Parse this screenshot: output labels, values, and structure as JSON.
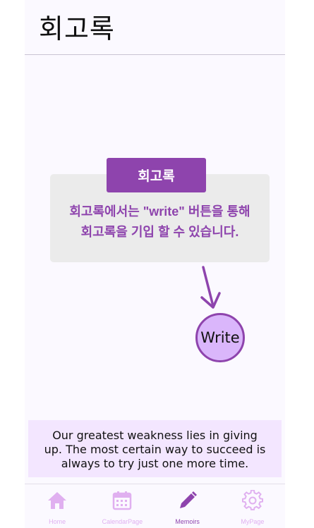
{
  "header": {
    "title": "회고록"
  },
  "info": {
    "tag": "회고록",
    "description_line1": "회고록에서는 \"write\" 버튼을 통해",
    "description_line2": "회고록을 기입 할 수 있습니다."
  },
  "write_button": {
    "label": "Write"
  },
  "quote": {
    "line1": "Our greatest weakness lies in giving",
    "line2": "up. The most certain way to succeed is",
    "line3": "always to try just one more time."
  },
  "nav": {
    "items": [
      {
        "label": "Home",
        "icon": "home-icon",
        "active": false
      },
      {
        "label": "CalendarPage",
        "icon": "calendar-icon",
        "active": false
      },
      {
        "label": "Memoirs",
        "icon": "pencil-icon",
        "active": true
      },
      {
        "label": "MyPage",
        "icon": "gear-icon",
        "active": false
      }
    ]
  },
  "colors": {
    "accent": "#8e44ad",
    "light_accent": "#dab6fb",
    "inactive_nav": "#e0b0f0",
    "quote_bg": "#f3e6ff",
    "card_bg": "#ebebeb"
  }
}
